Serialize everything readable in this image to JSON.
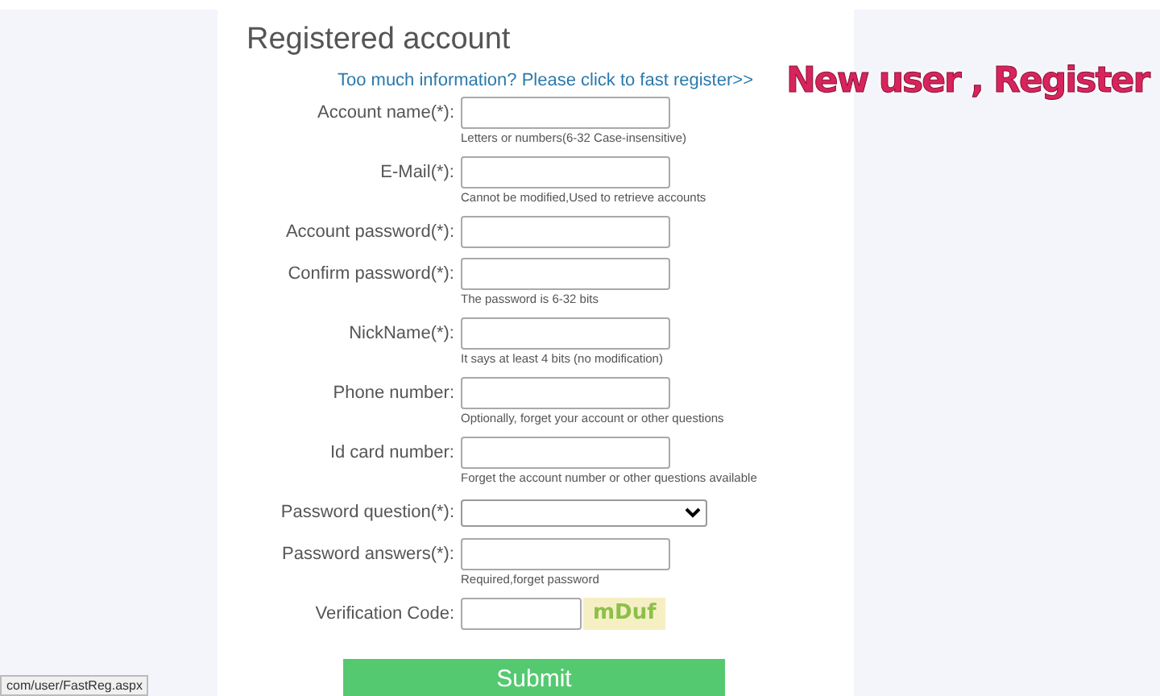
{
  "form": {
    "title": "Registered account",
    "fast_register_link": "Too much information? Please click to fast register>>",
    "fields": [
      {
        "label": "Account name(*):",
        "kind": "text",
        "hint": "Letters or numbers(6-32 Case-insensitive)"
      },
      {
        "label": "E-Mail(*):",
        "kind": "text",
        "hint": "Cannot be modified,Used to retrieve accounts"
      },
      {
        "label": "Account password(*):",
        "kind": "text"
      },
      {
        "label": "Confirm password(*):",
        "kind": "text",
        "hint": "The password is 6-32 bits"
      },
      {
        "label": "NickName(*):",
        "kind": "text",
        "hint": "It says at least 4 bits (no modification)"
      },
      {
        "label": "Phone number:",
        "kind": "text",
        "hint": "Optionally, forget your account or other questions"
      },
      {
        "label": "Id card number:",
        "kind": "text",
        "hint": "Forget the account number or other questions available"
      },
      {
        "label": "Password question(*):",
        "kind": "select"
      },
      {
        "label": "Password answers(*):",
        "kind": "text",
        "hint": "Required,forget password"
      },
      {
        "label": "Verification Code:",
        "kind": "captcha",
        "captcha": "mDuf"
      }
    ],
    "submit": "Submit"
  },
  "caption": "New user , Register",
  "status_url": "com/user/FastReg.aspx"
}
